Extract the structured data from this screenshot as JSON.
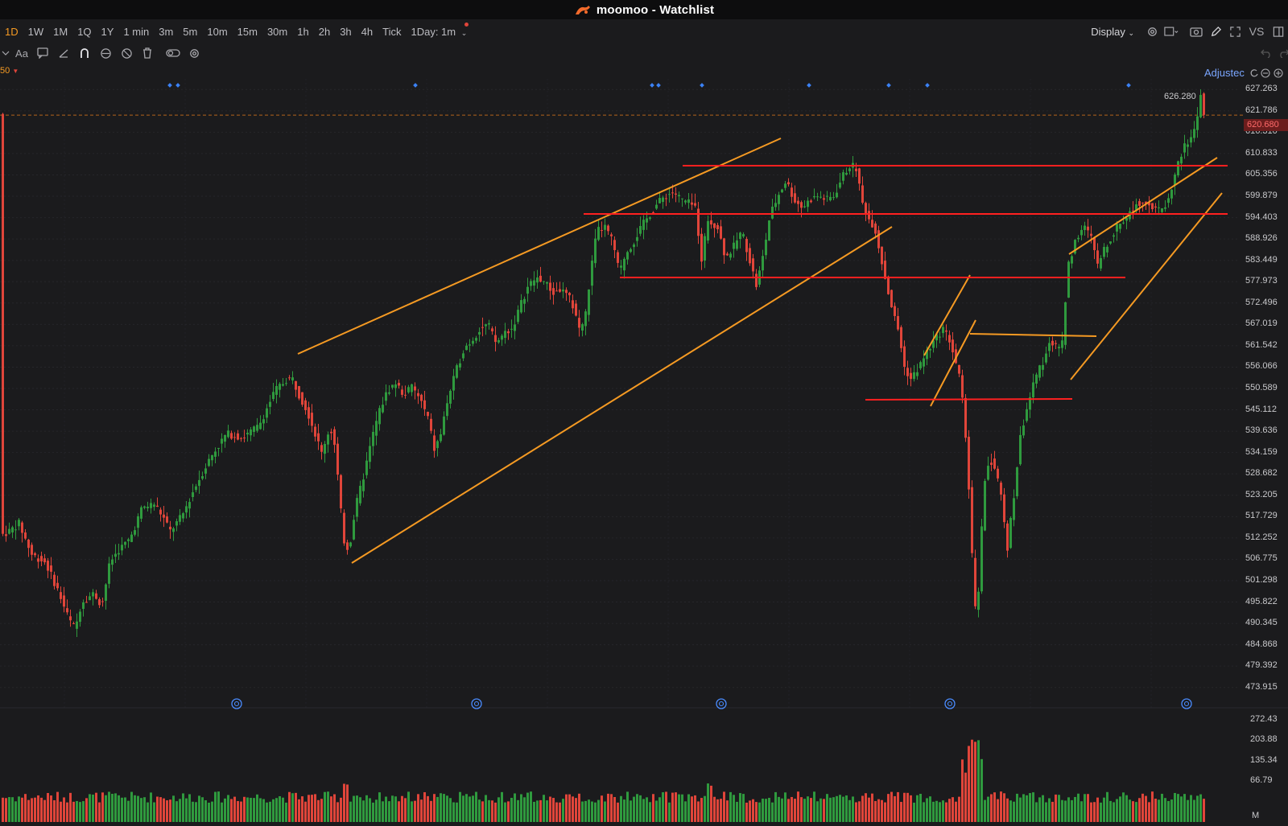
{
  "window": {
    "app_name": "moomoo - Watchlist"
  },
  "toolbar": {
    "timeframes": [
      {
        "label": "1D",
        "active": true
      },
      {
        "label": "1W",
        "active": false
      },
      {
        "label": "1M",
        "active": false
      },
      {
        "label": "1Q",
        "active": false
      },
      {
        "label": "1Y",
        "active": false
      },
      {
        "label": "1 min",
        "active": false
      },
      {
        "label": "3m",
        "active": false
      },
      {
        "label": "5m",
        "active": false
      },
      {
        "label": "10m",
        "active": false
      },
      {
        "label": "15m",
        "active": false
      },
      {
        "label": "30m",
        "active": false
      },
      {
        "label": "1h",
        "active": false
      },
      {
        "label": "2h",
        "active": false
      },
      {
        "label": "3h",
        "active": false
      },
      {
        "label": "4h",
        "active": false
      },
      {
        "label": "Tick",
        "active": false
      }
    ],
    "interval_select": "1Day: 1m",
    "display_label": "Display",
    "vs_label": "VS"
  },
  "chart": {
    "ma_label": "50",
    "adjusted_label": "Adjustec",
    "high_label": "626.280",
    "current_price": "620.680",
    "price_axis": [
      "627.263",
      "621.786",
      "616.310",
      "610.833",
      "605.356",
      "599.879",
      "594.403",
      "588.926",
      "583.449",
      "577.973",
      "572.496",
      "567.019",
      "561.542",
      "556.066",
      "550.589",
      "545.112",
      "539.636",
      "534.159",
      "528.682",
      "523.205",
      "517.729",
      "512.252",
      "506.775",
      "501.298",
      "495.822",
      "490.345",
      "484.868",
      "479.392",
      "473.915"
    ],
    "volume_axis": [
      "272.43",
      "203.88",
      "135.34",
      "66.79"
    ],
    "volume_unit": "M",
    "colors": {
      "up": "#2f9a3e",
      "down": "#e0453a",
      "trend_orange": "#f59a23",
      "level_red": "#ff2020",
      "background": "#1b1b1d"
    }
  },
  "chart_data": {
    "type": "candlestick",
    "ylim": [
      471.18,
      630.0
    ],
    "price_path": [
      [
        0,
        513
      ],
      [
        10,
        514
      ],
      [
        22,
        516
      ],
      [
        38,
        508
      ],
      [
        55,
        506
      ],
      [
        70,
        499
      ],
      [
        85,
        491
      ],
      [
        92,
        489
      ],
      [
        100,
        496
      ],
      [
        115,
        498
      ],
      [
        125,
        495
      ],
      [
        135,
        506
      ],
      [
        145,
        509
      ],
      [
        160,
        512
      ],
      [
        175,
        520
      ],
      [
        190,
        521
      ],
      [
        200,
        518
      ],
      [
        210,
        514
      ],
      [
        225,
        518
      ],
      [
        240,
        525
      ],
      [
        260,
        533
      ],
      [
        280,
        539
      ],
      [
        300,
        538
      ],
      [
        320,
        541
      ],
      [
        340,
        550
      ],
      [
        355,
        553
      ],
      [
        362,
        553
      ],
      [
        370,
        549
      ],
      [
        380,
        545
      ],
      [
        390,
        539
      ],
      [
        398,
        534
      ],
      [
        405,
        539
      ],
      [
        412,
        540
      ],
      [
        418,
        528
      ],
      [
        425,
        512
      ],
      [
        432,
        509
      ],
      [
        440,
        520
      ],
      [
        450,
        528
      ],
      [
        462,
        539
      ],
      [
        470,
        545
      ],
      [
        480,
        550
      ],
      [
        490,
        552
      ],
      [
        500,
        549
      ],
      [
        510,
        551
      ],
      [
        520,
        548
      ],
      [
        530,
        543
      ],
      [
        538,
        535
      ],
      [
        545,
        538
      ],
      [
        555,
        548
      ],
      [
        565,
        555
      ],
      [
        575,
        561
      ],
      [
        585,
        563
      ],
      [
        595,
        566
      ],
      [
        605,
        567
      ],
      [
        615,
        562
      ],
      [
        625,
        565
      ],
      [
        635,
        566
      ],
      [
        645,
        572
      ],
      [
        655,
        577
      ],
      [
        665,
        579
      ],
      [
        675,
        578
      ],
      [
        685,
        575
      ],
      [
        695,
        576
      ],
      [
        705,
        574
      ],
      [
        712,
        571
      ],
      [
        718,
        566
      ],
      [
        725,
        568
      ],
      [
        732,
        580
      ],
      [
        740,
        591
      ],
      [
        750,
        592
      ],
      [
        760,
        588
      ],
      [
        768,
        580
      ],
      [
        775,
        585
      ],
      [
        785,
        588
      ],
      [
        795,
        592
      ],
      [
        805,
        595
      ],
      [
        815,
        598
      ],
      [
        825,
        600
      ],
      [
        835,
        601
      ],
      [
        845,
        599
      ],
      [
        855,
        598
      ],
      [
        862,
        597
      ],
      [
        870,
        584
      ],
      [
        878,
        594
      ],
      [
        890,
        592
      ],
      [
        900,
        584
      ],
      [
        910,
        587
      ],
      [
        920,
        591
      ],
      [
        928,
        585
      ],
      [
        938,
        577
      ],
      [
        945,
        583
      ],
      [
        955,
        595
      ],
      [
        965,
        600
      ],
      [
        975,
        604
      ],
      [
        985,
        599
      ],
      [
        995,
        597
      ],
      [
        1005,
        599
      ],
      [
        1015,
        600
      ],
      [
        1025,
        599
      ],
      [
        1035,
        600
      ],
      [
        1045,
        605
      ],
      [
        1055,
        608
      ],
      [
        1062,
        607
      ],
      [
        1070,
        598
      ],
      [
        1078,
        594
      ],
      [
        1085,
        592
      ],
      [
        1092,
        585
      ],
      [
        1100,
        577
      ],
      [
        1108,
        570
      ],
      [
        1115,
        565
      ],
      [
        1122,
        556
      ],
      [
        1130,
        553
      ],
      [
        1140,
        556
      ],
      [
        1150,
        560
      ],
      [
        1160,
        563
      ],
      [
        1170,
        566
      ],
      [
        1178,
        563
      ],
      [
        1185,
        558
      ],
      [
        1192,
        552
      ],
      [
        1200,
        534
      ],
      [
        1205,
        511
      ],
      [
        1210,
        494
      ],
      [
        1215,
        499
      ],
      [
        1220,
        525
      ],
      [
        1228,
        533
      ],
      [
        1236,
        529
      ],
      [
        1242,
        523
      ],
      [
        1250,
        510
      ],
      [
        1258,
        523
      ],
      [
        1265,
        537
      ],
      [
        1272,
        544
      ],
      [
        1280,
        550
      ],
      [
        1288,
        555
      ],
      [
        1295,
        558
      ],
      [
        1302,
        563
      ],
      [
        1310,
        561
      ],
      [
        1318,
        562
      ],
      [
        1325,
        582
      ],
      [
        1335,
        589
      ],
      [
        1345,
        592
      ],
      [
        1355,
        589
      ],
      [
        1362,
        582
      ],
      [
        1370,
        586
      ],
      [
        1380,
        590
      ],
      [
        1390,
        593
      ],
      [
        1400,
        595
      ],
      [
        1410,
        598
      ],
      [
        1420,
        599
      ],
      [
        1430,
        597
      ],
      [
        1440,
        596
      ],
      [
        1450,
        599
      ],
      [
        1460,
        607
      ],
      [
        1468,
        612
      ],
      [
        1476,
        614
      ],
      [
        1484,
        618
      ],
      [
        1490,
        626
      ],
      [
        1494,
        621
      ]
    ]
  }
}
